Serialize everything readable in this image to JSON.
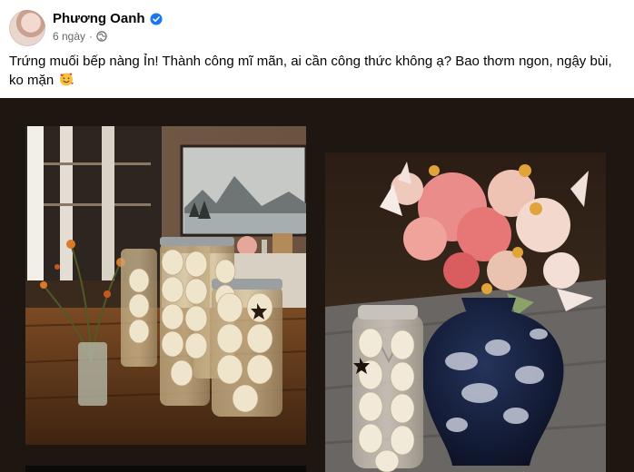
{
  "post": {
    "author": "Phương Oanh",
    "verified_icon": "verified-badge-icon",
    "time": "6 ngày",
    "separator": "·",
    "privacy_icon": "globe-icon",
    "text_main": "Trứng muối bếp nàng Ỉn! Thành công mĩ mãn, ai cần công thức không ạ? Bao thơm ngon, ngậy bùi, ko mặn",
    "text_emoji_icon": "smiling-face-with-hearts-icon"
  },
  "colors": {
    "verified": "#1877f2",
    "meta_text": "#65676b",
    "gallery_bg": "#1e1711"
  },
  "gallery": {
    "photos": [
      {
        "icon": "photo-pickled-eggs-jars"
      },
      {
        "icon": "photo-eggs-jar-and-flower-vase"
      },
      {
        "icon": "photo-dark-partial"
      }
    ]
  }
}
